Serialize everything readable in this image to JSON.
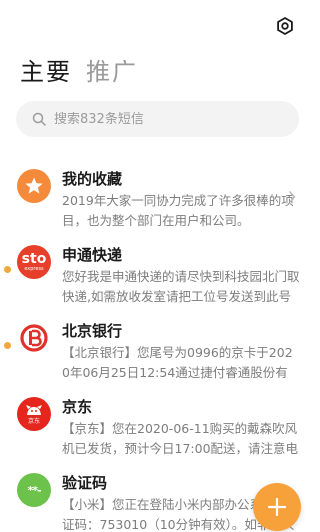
{
  "header": {
    "tabs": [
      {
        "label": "主要",
        "active": true
      },
      {
        "label": "推广",
        "active": false
      }
    ],
    "settings_icon": "gear-icon"
  },
  "search": {
    "placeholder": "搜索832条短信",
    "icon": "search-icon"
  },
  "colors": {
    "accent": "#f7a13a",
    "unread_dot": "#f0a93a",
    "favorites_avatar": "#f58a3a",
    "sto_avatar": "#e63f2a",
    "bob_avatar": "#e0312b",
    "jd_avatar": "#e4261d",
    "verify_avatar": "#6cc24a"
  },
  "conversations": [
    {
      "title": "我的收藏",
      "preview": "2019年大家一同协力完成了许多很棒的项目，也为整个部门在用户和公司。",
      "avatar": "star-icon",
      "unread": false,
      "chevron": true
    },
    {
      "title": "申通快递",
      "preview": "您好我是申通快递的请尽快到科技园北门取快递,如需放收发室请把工位号发送到此号码",
      "avatar": "sto-express-logo",
      "avatar_text": "sto",
      "avatar_subtext": "express",
      "unread": true
    },
    {
      "title": "北京银行",
      "preview": "【北京银行】您尾号为0996的京卡于2020年06月25日12:54通过捷付睿通股份有限公司",
      "avatar": "bank-of-beijing-logo",
      "unread": true
    },
    {
      "title": "京东",
      "preview": "【京东】您在2020-06-11购买的戴森吹风机已发货，预计今日17:00配送，请注意电话",
      "avatar": "jd-logo",
      "avatar_text": "京东",
      "unread": false
    },
    {
      "title": "验证码",
      "preview": "【小米】您正在登陆小米内部办公系统，验证码：753010（10分钟有效）。如非本人操作",
      "avatar": "verification-code-icon",
      "avatar_text": "**-",
      "unread": false
    }
  ],
  "fab": {
    "icon": "plus-icon"
  }
}
